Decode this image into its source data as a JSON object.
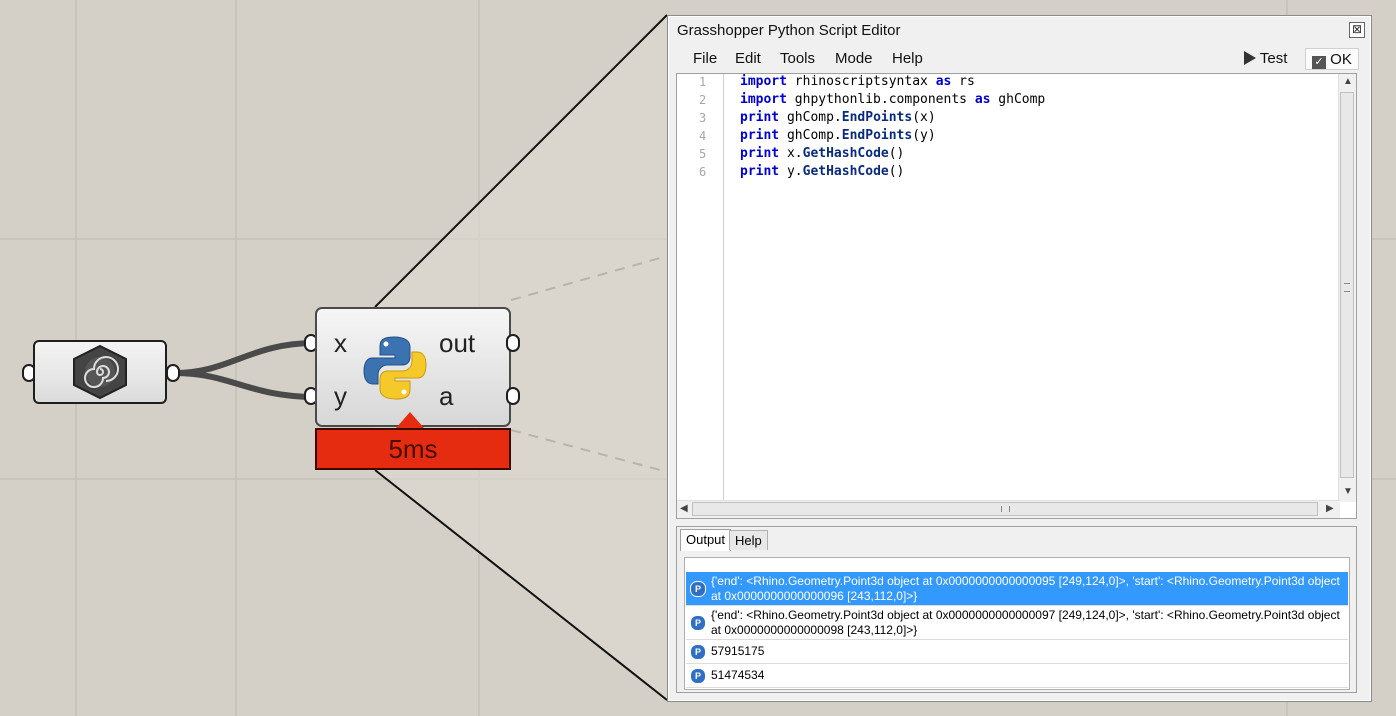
{
  "canvas": {
    "python_component": {
      "inputs": [
        "x",
        "y"
      ],
      "outputs": [
        "out",
        "a"
      ],
      "timer": "5ms"
    }
  },
  "editor": {
    "title": "Grasshopper Python Script Editor",
    "close_glyph": "⊠",
    "menu": [
      "File",
      "Edit",
      "Tools",
      "Mode",
      "Help"
    ],
    "test_label": "Test",
    "ok_label": "OK",
    "line_numbers": [
      "1",
      "2",
      "3",
      "4",
      "5",
      "6"
    ],
    "code": [
      {
        "kw": "import",
        "rest": " rhinoscriptsyntax ",
        "kw2": "as",
        "rest2": " rs"
      },
      {
        "kw": "import",
        "rest": " ghpythonlib.components ",
        "kw2": "as",
        "rest2": " ghComp"
      },
      {
        "kw": "print",
        "pre": " ghComp.",
        "fn": "EndPoints",
        "post": "(x)"
      },
      {
        "kw": "print",
        "pre": " ghComp.",
        "fn": "EndPoints",
        "post": "(y)"
      },
      {
        "kw": "print",
        "pre": " x.",
        "fn": "GetHashCode",
        "post": "()"
      },
      {
        "kw": "print",
        "pre": " y.",
        "fn": "GetHashCode",
        "post": "()"
      }
    ],
    "output_tabs": [
      "Output",
      "Help"
    ],
    "output_rows": [
      "{'end': <Rhino.Geometry.Point3d object at 0x0000000000000095 [249,124,0]>, 'start': <Rhino.Geometry.Point3d object at 0x0000000000000096 [243,112,0]>}",
      "{'end': <Rhino.Geometry.Point3d object at 0x0000000000000097 [249,124,0]>, 'start': <Rhino.Geometry.Point3d object at 0x0000000000000098 [243,112,0]>}",
      "57915175",
      "51474534"
    ],
    "selected_row": 0
  },
  "colors": {
    "canvas_bg": "#d4d0c8",
    "timer_red": "#e52c10",
    "keyword_blue": "#0000cc",
    "selection_blue": "#3399ff"
  }
}
